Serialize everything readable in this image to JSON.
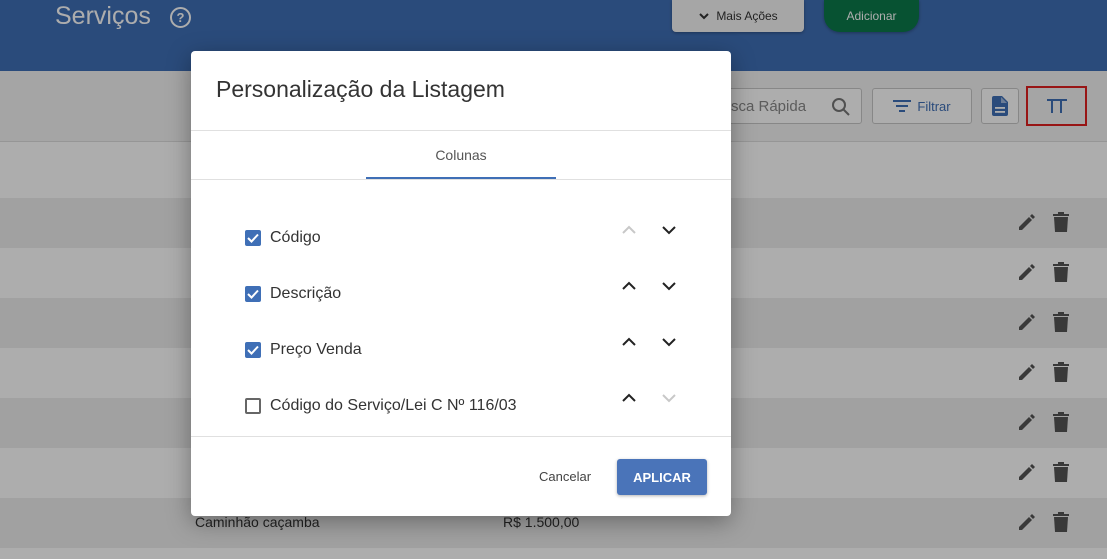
{
  "header": {
    "title": "Serviços",
    "help_icon": "help-circle-icon",
    "more_actions_label": "Mais Ações",
    "add_label": "Adicionar"
  },
  "toolbar": {
    "search_placeholder": "Busca Rápida",
    "search_visible_text": "sca Rápida",
    "filter_label": "Filtrar",
    "doc_icon": "document-icon",
    "columns_icon": "columns-icon"
  },
  "table": {
    "rows": [
      {
        "description": "",
        "price": ""
      },
      {
        "description": "",
        "price": ""
      },
      {
        "description": "",
        "price": ""
      },
      {
        "description": "",
        "price": ""
      },
      {
        "description": "",
        "price": ""
      },
      {
        "description": "",
        "price": ""
      },
      {
        "description": "Caminhão caçamba",
        "price": "R$ 1.500,00"
      }
    ]
  },
  "modal": {
    "title": "Personalização da Listagem",
    "tab_label": "Colunas",
    "columns": [
      {
        "label": "Código",
        "checked": true,
        "up_enabled": false,
        "down_enabled": true
      },
      {
        "label": "Descrição",
        "checked": true,
        "up_enabled": true,
        "down_enabled": true
      },
      {
        "label": "Preço Venda",
        "checked": true,
        "up_enabled": true,
        "down_enabled": true
      },
      {
        "label": "Código do Serviço/Lei C Nº 116/03",
        "checked": false,
        "up_enabled": true,
        "down_enabled": false
      }
    ],
    "cancel_label": "Cancelar",
    "apply_label": "APLICAR"
  },
  "colors": {
    "header_blue": "#3f6fb6",
    "add_green": "#0b7a4b",
    "highlight_red": "#e02020",
    "apply_blue": "#4a74b9"
  }
}
